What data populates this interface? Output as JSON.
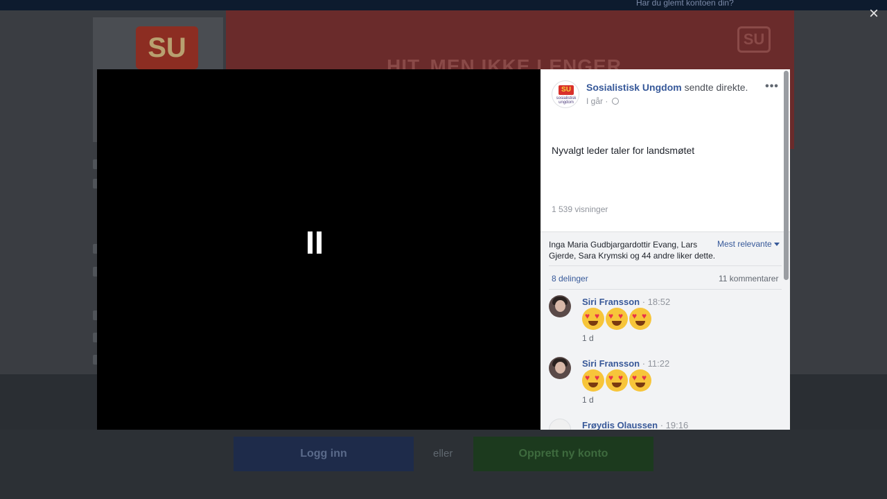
{
  "background": {
    "topbar_text": "Har du glemt kontoen din?",
    "banner_text": "HIT, MEN IKKE LENGER",
    "logo_text": "SU",
    "login_button": "Logg inn",
    "or_text": "eller",
    "signup_button": "Opprett ny konto"
  },
  "close_label": "×",
  "post": {
    "page_name": "Sosialistisk Ungdom",
    "action": "sendte direkte.",
    "time": "I går",
    "more_label": "•••",
    "avatar_text": "SU",
    "avatar_caption": "sosialistisk ungdom",
    "text": "Nyvalgt leder taler for landsmøtet",
    "views": "1 539 visninger"
  },
  "feedback": {
    "likes_text": "Inga Maria Gudbjargardottir Evang, Lars Gjerde, Sara Krymski og 44 andre liker dette.",
    "sort_label": "Mest relevante",
    "shares": "8 delinger",
    "comments_count": "11 kommentarer"
  },
  "comments": [
    {
      "author": "Siri Fransson",
      "time": "· 18:52",
      "age": "1 d"
    },
    {
      "author": "Siri Fransson",
      "time": "· 11:22",
      "age": "1 d"
    },
    {
      "author": "Frøydis Olaussen",
      "time": "· 19:16"
    }
  ],
  "colors": {
    "link_blue": "#365899",
    "video_bg": "#000000",
    "emoji_yellow": "#f7c53a"
  }
}
